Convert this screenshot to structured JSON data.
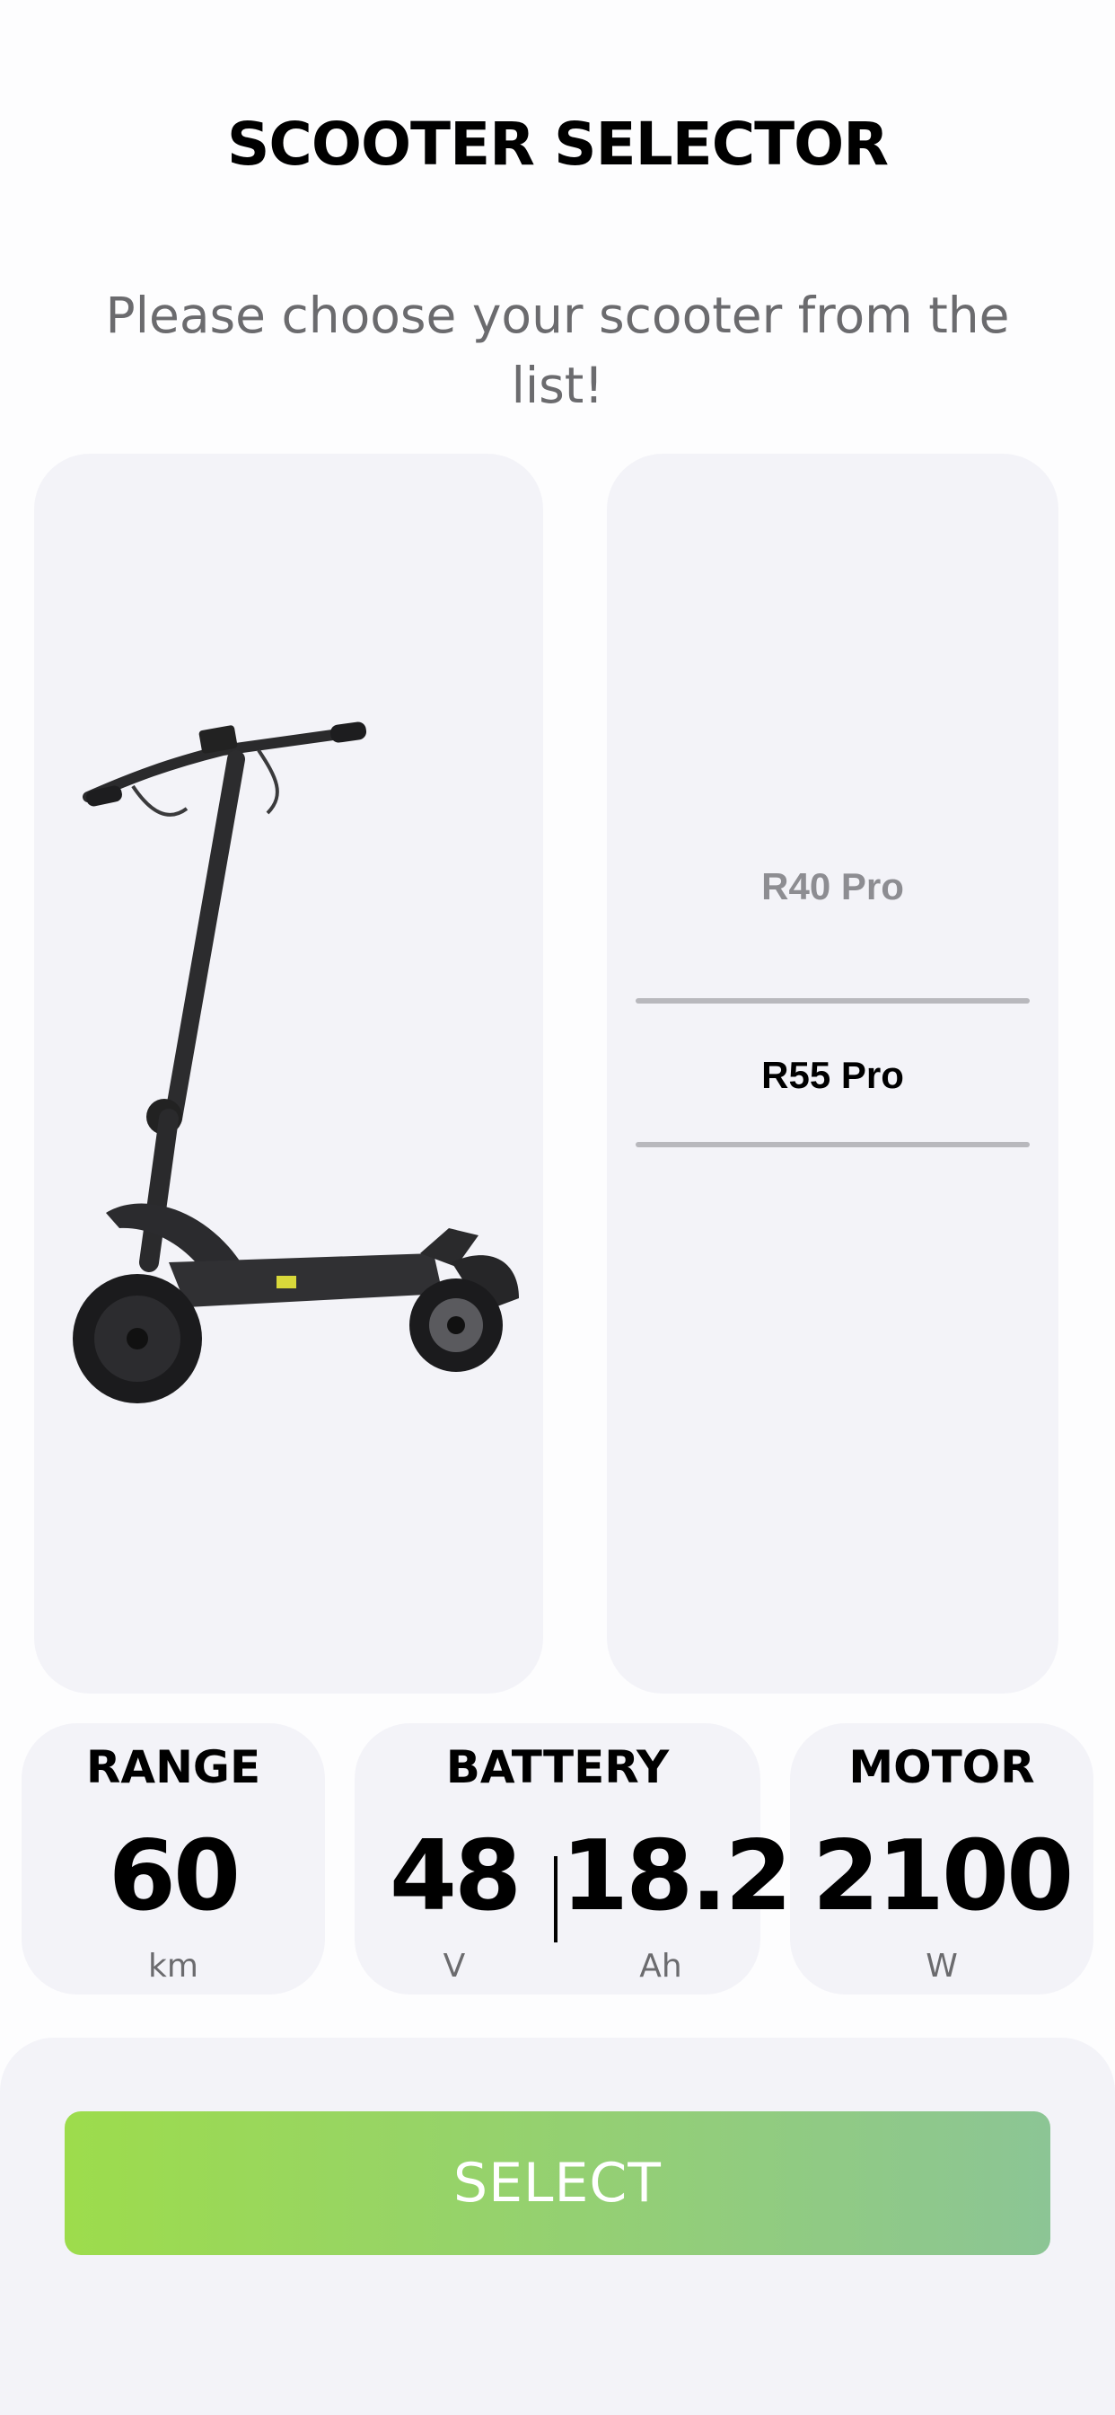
{
  "header": {
    "title": "SCOOTER SELECTOR",
    "subtitle": "Please choose your scooter from the list!"
  },
  "picker": {
    "items": [
      "R40 Pro",
      "R55 Pro"
    ],
    "selected": "R55 Pro"
  },
  "stats": {
    "range": {
      "title": "RANGE",
      "value": "60",
      "unit": "km"
    },
    "battery": {
      "title": "BATTERY",
      "voltage": "48",
      "voltage_unit": "V",
      "capacity": "18.2",
      "capacity_unit": "Ah"
    },
    "motor": {
      "title": "MOTOR",
      "value": "2100",
      "unit": "W"
    }
  },
  "actions": {
    "select_label": "SELECT"
  },
  "colors": {
    "button_gradient_start": "#9ddc4c",
    "button_gradient_end": "#8cc595",
    "card_bg": "#f3f3f8"
  }
}
